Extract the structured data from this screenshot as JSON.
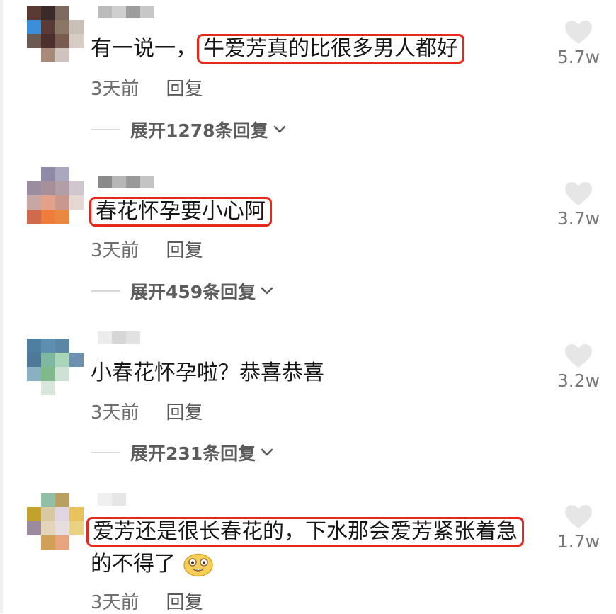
{
  "comments": [
    {
      "prefix": "有一说一，",
      "highlight": "牛爱芳真的比很多男人都好",
      "suffix": "",
      "line2": "",
      "time": "3天前",
      "reply": "回复",
      "expand": "展开1278条回复",
      "likes": "5.7w",
      "highlighted": true
    },
    {
      "prefix": "",
      "highlight": "春花怀孕要小心阿",
      "suffix": "",
      "line2": "",
      "time": "3天前",
      "reply": "回复",
      "expand": "展开459条回复",
      "likes": "3.7w",
      "highlighted": true
    },
    {
      "prefix": "小春花怀孕啦？恭喜恭喜",
      "highlight": "",
      "suffix": "",
      "line2": "",
      "time": "3天前",
      "reply": "回复",
      "expand": "展开231条回复",
      "likes": "3.2w",
      "highlighted": false
    },
    {
      "prefix": "",
      "highlight": "爱芳还是很长春花的，下水那会爱芳紧张着急",
      "suffix": "",
      "line2": "的不得了",
      "time": "3天前",
      "reply": "回复",
      "expand": "",
      "likes": "1.7w",
      "highlighted": true
    }
  ],
  "icons": {
    "like": "heart-icon",
    "expand": "chevron-down-icon",
    "emoji": "smiling-face-icon"
  },
  "colors": {
    "highlight_border": "#e8281b",
    "text": "#161616",
    "meta": "#6f6f6f",
    "heart": "#e6e6e6"
  }
}
